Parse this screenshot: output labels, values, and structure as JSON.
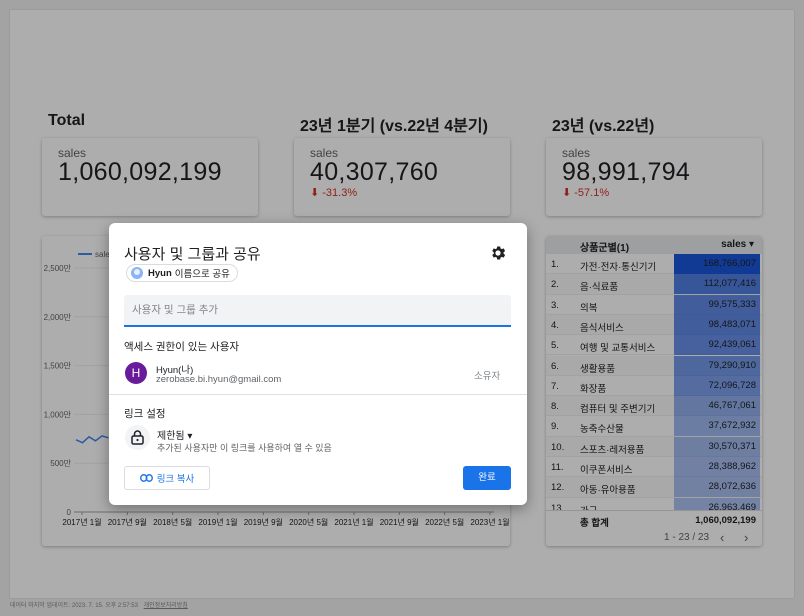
{
  "scorecards": [
    {
      "title": "Total",
      "label": "sales",
      "value": "1,060,092,199",
      "delta": ""
    },
    {
      "title": "23년 1분기 (vs.22년 4분기)",
      "label": "sales",
      "value": "40,307,760",
      "delta": "⬇ -31.3%"
    },
    {
      "title": "23년 (vs.22년)",
      "label": "sales",
      "value": "98,991,794",
      "delta": "⬇ -57.1%"
    }
  ],
  "chart_data": {
    "type": "line",
    "legend": "sales",
    "y_ticks": [
      "2,500만",
      "2,000만",
      "1,500만",
      "1,000만",
      "500만",
      "0"
    ],
    "x_ticks": [
      "2017년 1월",
      "2017년 9월",
      "2018년 5월",
      "2019년 1월",
      "2019년 9월",
      "2020년 5월",
      "2021년 1월",
      "2021년 9월",
      "2022년 5월",
      "2023년 1월"
    ],
    "ylim": [
      0,
      25000000
    ],
    "visible_series": [
      {
        "name": "sales",
        "x": [
          "2017-01",
          "2017-02",
          "2017-03",
          "2017-04",
          "2017-05",
          "2017-06"
        ],
        "values": [
          7400000,
          7100000,
          7700000,
          7300000,
          7800000,
          7600000
        ]
      }
    ],
    "line_color": "#4285f4"
  },
  "table": {
    "col_category": "상품군별(1)",
    "col_sales": "sales ▾",
    "rows": [
      {
        "rank": "1.",
        "category": "가전·전자·통신기기",
        "sales": "168,766,007",
        "ratio": 1.0
      },
      {
        "rank": "2.",
        "category": "음·식료품",
        "sales": "112,077,416",
        "ratio": 0.664
      },
      {
        "rank": "3.",
        "category": "의복",
        "sales": "99,575,333",
        "ratio": 0.59
      },
      {
        "rank": "4.",
        "category": "음식서비스",
        "sales": "98,483,071",
        "ratio": 0.584
      },
      {
        "rank": "5.",
        "category": "여행 및 교통서비스",
        "sales": "92,439,061",
        "ratio": 0.548
      },
      {
        "rank": "6.",
        "category": "생활용품",
        "sales": "79,290,910",
        "ratio": 0.47
      },
      {
        "rank": "7.",
        "category": "화장품",
        "sales": "72,096,728",
        "ratio": 0.427
      },
      {
        "rank": "8.",
        "category": "컴퓨터 및 주변기기",
        "sales": "46,767,061",
        "ratio": 0.277
      },
      {
        "rank": "9.",
        "category": "농축수산물",
        "sales": "37,672,932",
        "ratio": 0.223
      },
      {
        "rank": "10.",
        "category": "스포츠·레저용품",
        "sales": "30,570,371",
        "ratio": 0.181
      },
      {
        "rank": "11.",
        "category": "이쿠폰서비스",
        "sales": "28,388,962",
        "ratio": 0.168
      },
      {
        "rank": "12.",
        "category": "아동·유아용품",
        "sales": "28,072,636",
        "ratio": 0.166
      },
      {
        "rank": "13.",
        "category": "가구",
        "sales": "26,963,469",
        "ratio": 0.16
      }
    ],
    "total_label": "총 합계",
    "total_value": "1,060,092,199",
    "pagination": "1 - 23 / 23",
    "bar_color": "#1a56db"
  },
  "footer": {
    "updated": "데이터 마지막 업데이트: 2023. 7. 15. 오후 2:57:53",
    "policy": "개인정보처리방침"
  },
  "dialog": {
    "title": "사용자 및 그룹과 공유",
    "chip_name": "Hyun",
    "chip_suffix": "이름으로 공유",
    "add_placeholder": "사용자 및 그룹 추가",
    "access_heading": "액세스 권한이 있는 사용자",
    "user_initial": "H",
    "user_name": "Hyun(나)",
    "user_email": "zerobase.bi.hyun@gmail.com",
    "user_role": "소유자",
    "link_heading": "링크 설정",
    "access_level": "제한됨 ▾",
    "access_desc": "추가된 사용자만 이 링크를 사용하여 열 수 있음",
    "copy_link": "링크 복사",
    "done": "완료"
  }
}
